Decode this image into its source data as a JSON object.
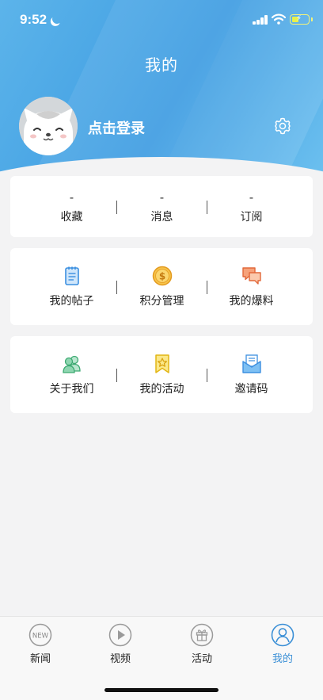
{
  "status_bar": {
    "time": "9:52"
  },
  "header": {
    "title": "我的",
    "login_label": "点击登录"
  },
  "stats": [
    {
      "value": "-",
      "label": "收藏"
    },
    {
      "value": "-",
      "label": "消息"
    },
    {
      "value": "-",
      "label": "订阅"
    }
  ],
  "menu_row_1": [
    {
      "label": "我的帖子",
      "icon": "note-icon"
    },
    {
      "label": "积分管理",
      "icon": "coin-icon"
    },
    {
      "label": "我的爆料",
      "icon": "chat-bubbles-icon"
    }
  ],
  "menu_row_2": [
    {
      "label": "关于我们",
      "icon": "people-icon"
    },
    {
      "label": "我的活动",
      "icon": "bookmark-star-icon"
    },
    {
      "label": "邀请码",
      "icon": "envelope-icon"
    }
  ],
  "tabbar": {
    "items": [
      {
        "label": "新闻",
        "icon": "news-icon",
        "badge": "NEW"
      },
      {
        "label": "视频",
        "icon": "play-icon"
      },
      {
        "label": "活动",
        "icon": "gift-icon"
      },
      {
        "label": "我的",
        "icon": "user-icon",
        "active": true
      }
    ]
  },
  "colors": {
    "header": "#4aa6e6",
    "accent": "#3a8fd6",
    "background": "#f3f3f4"
  }
}
